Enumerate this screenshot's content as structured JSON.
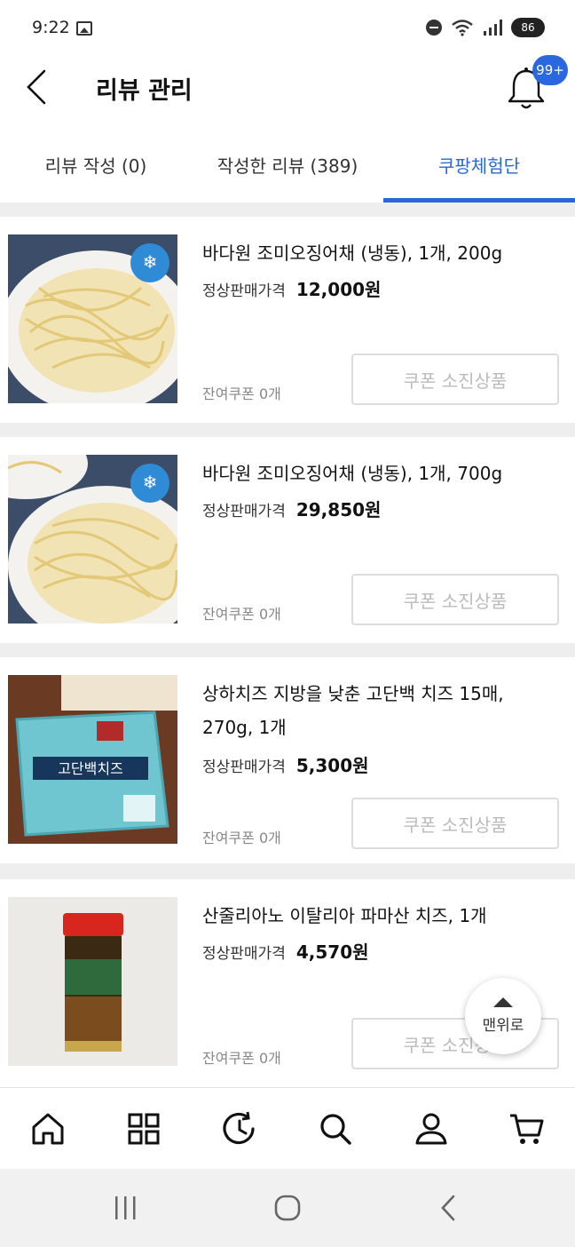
{
  "status_bar": {
    "time": "9:22",
    "battery": "86",
    "icons": [
      "image-icon",
      "dnd-icon",
      "wifi-icon",
      "signal-icon",
      "battery-icon"
    ]
  },
  "header": {
    "title": "리뷰 관리",
    "notification_badge": "99+"
  },
  "tabs": [
    {
      "label": "리뷰 작성 (0)",
      "active": false
    },
    {
      "label": "작성한 리뷰 (389)",
      "active": false
    },
    {
      "label": "쿠팡체험단",
      "active": true
    }
  ],
  "products": [
    {
      "title": "바다원 조미오징어채 (냉동), 1개, 200g",
      "price_label": "정상판매가격",
      "price": "12,000원",
      "coupon_left": "잔여쿠폰 0개",
      "button": "쿠폰 소진상품",
      "frozen_badge": "냉동"
    },
    {
      "title": "바다원 조미오징어채 (냉동), 1개, 700g",
      "price_label": "정상판매가격",
      "price": "29,850원",
      "coupon_left": "잔여쿠폰 0개",
      "button": "쿠폰 소진상품",
      "frozen_badge": "냉동"
    },
    {
      "title": "상하치즈 지방을 낮춘 고단백 치즈 15매, 270g, 1개",
      "price_label": "정상판매가격",
      "price": "5,300원",
      "coupon_left": "잔여쿠폰 0개",
      "button": "쿠폰 소진상품",
      "package_text": "고단백치즈"
    },
    {
      "title": "산줄리아노 이탈리아 파마산 치즈, 1개",
      "price_label": "정상판매가격",
      "price": "4,570원",
      "coupon_left": "잔여쿠폰 0개",
      "button": "쿠폰 소진상품"
    }
  ],
  "scroll_top_label": "맨위로",
  "bottom_nav": [
    "home-icon",
    "category-icon",
    "recent-icon",
    "search-icon",
    "account-icon",
    "cart-icon"
  ],
  "colors": {
    "accent": "#2a66d6",
    "badge": "#2b68e0",
    "divider": "#eeeeee",
    "disabled_text": "#bbbbbb"
  }
}
